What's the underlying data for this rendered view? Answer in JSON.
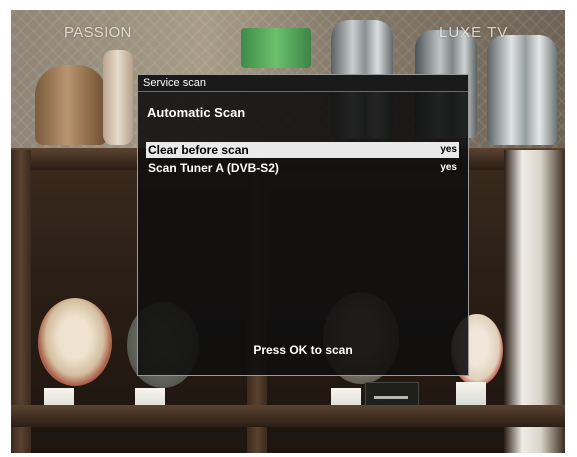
{
  "channel": {
    "left": "PASSION",
    "right": "LUXE TV"
  },
  "dialog": {
    "title": "Service scan",
    "heading": "Automatic Scan",
    "options": [
      {
        "label": "Clear before scan",
        "value": "yes",
        "selected": true
      },
      {
        "label": "Scan Tuner A (DVB-S2)",
        "value": "yes",
        "selected": false
      }
    ],
    "hint": "Press OK to scan"
  },
  "colors": {
    "dialog_background": "#101010",
    "dialog_border": "#9a9a9a",
    "selected_row": "#e9e9e9",
    "text": "#ffffff"
  }
}
